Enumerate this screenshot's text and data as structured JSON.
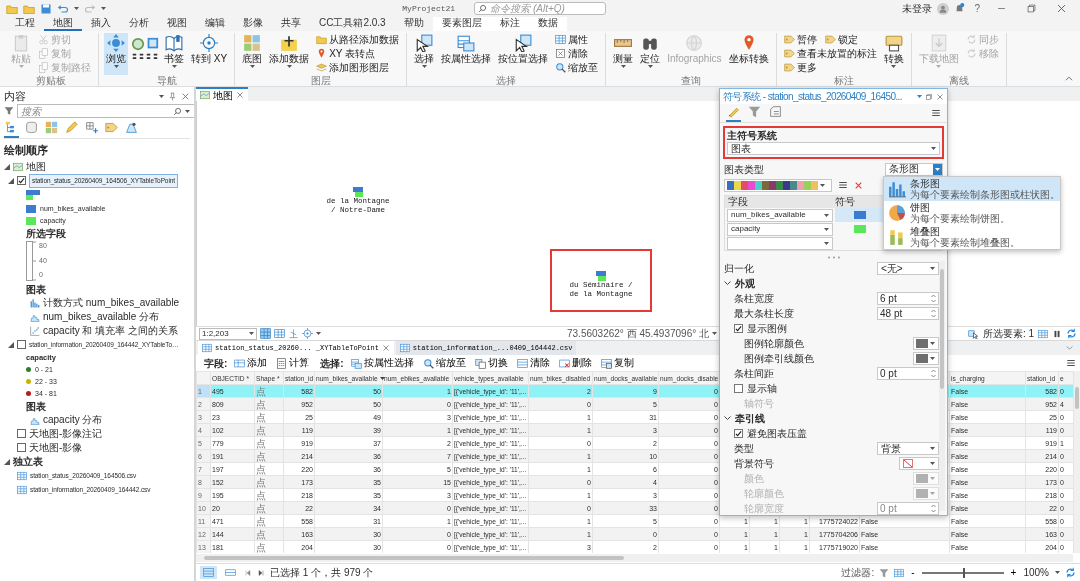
{
  "title_bar": {
    "project": "MyProject21",
    "search": {
      "placeholder": "命令搜索 (Alt+Q)"
    },
    "user": "未登录",
    "help": "?"
  },
  "ribbon_tabs": [
    {
      "label": "工程",
      "kind": "main",
      "selected": false
    },
    {
      "label": "地图",
      "kind": "main",
      "selected": true
    },
    {
      "label": "插入",
      "kind": "main",
      "selected": false
    },
    {
      "label": "分析",
      "kind": "main",
      "selected": false
    },
    {
      "label": "视图",
      "kind": "main",
      "selected": false
    },
    {
      "label": "编辑",
      "kind": "main",
      "selected": false
    },
    {
      "label": "影像",
      "kind": "main",
      "selected": false
    },
    {
      "label": "共享",
      "kind": "main",
      "selected": false
    },
    {
      "label": "CC工具箱2.0.3",
      "kind": "main",
      "selected": false
    },
    {
      "label": "帮助",
      "kind": "main",
      "selected": false
    },
    {
      "label": "要素图层",
      "kind": "context",
      "selected": false
    },
    {
      "label": "标注",
      "kind": "context",
      "selected": false
    },
    {
      "label": "数据",
      "kind": "context",
      "selected": false
    }
  ],
  "ribbon_groups": [
    {
      "title": "剪贴板",
      "columns": [
        {
          "kind": "large",
          "label": "粘贴",
          "dropdown": true,
          "disabled": true,
          "selected": false
        },
        {
          "kind": "stack",
          "rows": [
            [
              {
                "label": "剪切",
                "disabled": true
              }
            ],
            [
              {
                "label": "复制",
                "disabled": true
              }
            ],
            [
              {
                "label": "复制路径",
                "disabled": true
              }
            ]
          ]
        }
      ]
    },
    {
      "title": "导航",
      "columns": [
        {
          "kind": "large",
          "label": "浏览",
          "dropdown": true,
          "disabled": false,
          "selected": true
        },
        {
          "kind": "tools"
        },
        {
          "kind": "large",
          "label": "书签",
          "dropdown": true,
          "disabled": false,
          "selected": false
        },
        {
          "kind": "large",
          "label": "转到 XY",
          "dropdown": false,
          "disabled": false,
          "selected": false
        }
      ]
    },
    {
      "title": "图层",
      "columns": [
        {
          "kind": "large",
          "label": "底图",
          "dropdown": true,
          "disabled": false,
          "selected": false
        },
        {
          "kind": "large",
          "label": "添加数据",
          "dropdown": true,
          "disabled": false,
          "selected": false
        },
        {
          "kind": "stack",
          "rows": [
            [
              {
                "label": "从路径添加数据",
                "disabled": false
              }
            ],
            [
              {
                "label": "XY 表转点",
                "disabled": false
              }
            ],
            [
              {
                "label": "添加图形图层",
                "disabled": false
              }
            ]
          ]
        }
      ]
    },
    {
      "title": "选择",
      "columns": [
        {
          "kind": "large",
          "label": "选择",
          "dropdown": true,
          "disabled": false,
          "selected": false
        },
        {
          "kind": "large",
          "label": "按属性选择",
          "dropdown": false,
          "disabled": false,
          "selected": false
        },
        {
          "kind": "large",
          "label": "按位置选择",
          "dropdown": false,
          "disabled": false,
          "selected": false
        },
        {
          "kind": "stack",
          "rows": [
            [
              {
                "label": "属性",
                "disabled": false
              }
            ],
            [
              {
                "label": "清除",
                "disabled": false
              }
            ],
            [
              {
                "label": "缩放至",
                "disabled": false
              }
            ]
          ]
        }
      ]
    },
    {
      "title": "查询",
      "columns": [
        {
          "kind": "large",
          "label": "测量",
          "dropdown": true,
          "disabled": false,
          "selected": false
        },
        {
          "kind": "large",
          "label": "定位",
          "dropdown": true,
          "disabled": false,
          "selected": false
        },
        {
          "kind": "large",
          "label": "Infographics",
          "dropdown": false,
          "disabled": true,
          "selected": false
        },
        {
          "kind": "large",
          "label": "坐标转换",
          "dropdown": false,
          "disabled": false,
          "selected": false
        }
      ]
    },
    {
      "title": "标注",
      "columns": [
        {
          "kind": "stack",
          "rows": [
            [
              {
                "label": "暂停",
                "disabled": false
              },
              {
                "label": "锁定",
                "disabled": false
              }
            ],
            [
              {
                "label": "查看未放置的标注",
                "disabled": false
              }
            ],
            [
              {
                "label": "更多",
                "disabled": false
              }
            ]
          ]
        },
        {
          "kind": "large",
          "label": "转换",
          "dropdown": true,
          "disabled": false,
          "selected": false
        }
      ]
    },
    {
      "title": "离线",
      "columns": [
        {
          "kind": "large",
          "label": "下载地图",
          "dropdown": true,
          "disabled": true,
          "selected": false
        },
        {
          "kind": "stack",
          "rows": [
            [
              {
                "label": "同步",
                "disabled": true
              }
            ],
            [
              {
                "label": "移除",
                "disabled": true
              }
            ]
          ]
        }
      ]
    }
  ],
  "contents": {
    "title": "内容",
    "search": {
      "placeholder": "搜索"
    },
    "view_tabs": [
      {
        "selected": true
      },
      {
        "selected": false
      },
      {
        "selected": false
      },
      {
        "selected": false
      },
      {
        "selected": false
      },
      {
        "selected": false
      },
      {
        "selected": false
      }
    ],
    "heading": "绘制顺序",
    "tree": [
      {
        "kind": "map",
        "label": "地图",
        "expanded": true,
        "children": [
          {
            "kind": "layer",
            "label": "station_status_20260409_164506_XYTableToPoint",
            "checked": true,
            "selected": true,
            "expanded": true,
            "legend": {
              "kind": "chart",
              "entries": [
                {
                  "label": "num_bikes_available",
                  "color": "#3d7bd0"
                },
                {
                  "label": "capacity",
                  "color": "#5ae85a"
                }
              ],
              "field_heading": "所选字段",
              "scale": [
                "80",
                "40",
                "0"
              ],
              "charts_heading": "图表",
              "charts": [
                {
                  "label": "计数方式 num_bikes_available",
                  "kind": "bar"
                },
                {
                  "label": "num_bikes_available 分布",
                  "kind": "histogram"
                },
                {
                  "label": "capacity 和 填充率 之间的关系",
                  "kind": "scatter"
                }
              ]
            }
          },
          {
            "kind": "layer",
            "label": "station_information_20260409_164442_XYTableTo…",
            "checked": false,
            "selected": false,
            "expanded": true,
            "legend": {
              "kind": "classes",
              "field_heading": "capacity",
              "entries": [
                {
                  "label": "0 - 21",
                  "color": "#2e7d32"
                },
                {
                  "label": "22 - 33",
                  "color": "#c8b400"
                },
                {
                  "label": "34 - 81",
                  "color": "#b71c1c"
                }
              ],
              "charts_heading": "图表",
              "charts": [
                {
                  "label": "capacity 分布",
                  "kind": "histogram"
                }
              ]
            }
          },
          {
            "kind": "layer",
            "label": "天地图-影像注记",
            "checked": false,
            "selected": false
          },
          {
            "kind": "layer",
            "label": "天地图-影像",
            "checked": false,
            "selected": false
          }
        ]
      },
      {
        "kind": "group",
        "label": "独立表",
        "expanded": true,
        "children": [
          {
            "kind": "table",
            "label": "station_status_20260409_164506.csv"
          },
          {
            "kind": "table",
            "label": "station_information_20260409_164442.csv"
          }
        ]
      }
    ]
  },
  "map_view": {
    "tab": {
      "label": "地图",
      "selected": true
    },
    "features": [
      {
        "lines": [
          "de la Montagne",
          "/ Notre-Dame"
        ],
        "highlighted": false
      },
      {
        "lines": [
          "du Séminaire /",
          "de la Montagne"
        ],
        "highlighted": true
      }
    ],
    "scale": "1:2,203",
    "coordinates": "73.5603262° 西 45.4937096° 北",
    "selected_features": "所选要素: 1"
  },
  "table": {
    "tabs": [
      {
        "label": "station_status_20260... _XYTableToPoint",
        "selected": true,
        "closable": true
      },
      {
        "label": "station_information_...0409_164442.csv",
        "selected": false,
        "closable": false
      }
    ],
    "toolbar": [
      {
        "kind": "label",
        "label": "字段:"
      },
      {
        "kind": "button",
        "label": "添加"
      },
      {
        "kind": "button",
        "label": "计算"
      },
      {
        "kind": "label",
        "label": "选择:"
      },
      {
        "kind": "button",
        "label": "按属性选择"
      },
      {
        "kind": "button",
        "label": "缩放至"
      },
      {
        "kind": "button",
        "label": "切换"
      },
      {
        "kind": "button",
        "label": "清除"
      },
      {
        "kind": "button",
        "label": "删除"
      },
      {
        "kind": "button",
        "label": "复制"
      }
    ],
    "columns": [
      {
        "label": "OBJECTID *",
        "sorted": false
      },
      {
        "label": "Shape *",
        "sorted": false
      },
      {
        "label": "station_id",
        "sorted": false
      },
      {
        "label": "num_bikes_available",
        "sorted": true
      },
      {
        "label": "num_ebikes_available",
        "sorted": false
      },
      {
        "label": "vehicle_types_available",
        "sorted": false
      },
      {
        "label": "num_bikes_disabled",
        "sorted": false
      },
      {
        "label": "num_docks_available",
        "sorted": false
      },
      {
        "label": "num_docks_disable",
        "sorted": false
      },
      null,
      null,
      null,
      null,
      null,
      {
        "label": "is_charging",
        "sorted": false
      },
      {
        "label": "station_id",
        "sorted": false
      },
      {
        "label": "e",
        "sorted": false
      }
    ],
    "rows": [
      {
        "number": "1",
        "selected": true,
        "cells": [
          "495",
          "点",
          "582",
          "50",
          "1",
          "[{'vehicle_type_id': '11',...",
          "2",
          "9",
          "0",
          null,
          null,
          null,
          null,
          null,
          "False",
          "582",
          "0"
        ]
      },
      {
        "number": "2",
        "selected": false,
        "cells": [
          "809",
          "点",
          "952",
          "50",
          "0",
          "[{'vehicle_type_id': '11',...",
          "0",
          "5",
          "0",
          null,
          null,
          null,
          null,
          null,
          "False",
          "952",
          "4"
        ]
      },
      {
        "number": "3",
        "selected": false,
        "cells": [
          "23",
          "点",
          "25",
          "49",
          "3",
          "[{'vehicle_type_id': '11',...",
          "1",
          "31",
          "0",
          null,
          null,
          null,
          null,
          null,
          "False",
          "25",
          "0"
        ]
      },
      {
        "number": "4",
        "selected": false,
        "cells": [
          "102",
          "点",
          "119",
          "39",
          "1",
          "[{'vehicle_type_id': '11',...",
          "1",
          "3",
          "0",
          null,
          null,
          null,
          null,
          null,
          "False",
          "119",
          "0"
        ]
      },
      {
        "number": "5",
        "selected": false,
        "cells": [
          "779",
          "点",
          "919",
          "37",
          "2",
          "[{'vehicle_type_id': '11',...",
          "0",
          "2",
          "0",
          null,
          null,
          null,
          null,
          null,
          "False",
          "919",
          "1"
        ]
      },
      {
        "number": "6",
        "selected": false,
        "cells": [
          "191",
          "点",
          "214",
          "36",
          "7",
          "[{'vehicle_type_id': '11',...",
          "1",
          "10",
          "0",
          null,
          null,
          null,
          null,
          null,
          "False",
          "214",
          "0"
        ]
      },
      {
        "number": "7",
        "selected": false,
        "cells": [
          "197",
          "点",
          "220",
          "36",
          "5",
          "[{'vehicle_type_id': '11',...",
          "1",
          "6",
          "0",
          null,
          null,
          null,
          null,
          null,
          "False",
          "220",
          "0"
        ]
      },
      {
        "number": "8",
        "selected": false,
        "cells": [
          "152",
          "点",
          "173",
          "35",
          "15",
          "[{'vehicle_type_id': '11',...",
          "0",
          "4",
          "0",
          null,
          null,
          null,
          null,
          null,
          "False",
          "173",
          "0"
        ]
      },
      {
        "number": "9",
        "selected": false,
        "cells": [
          "195",
          "点",
          "218",
          "35",
          "3",
          "[{'vehicle_type_id': '11',...",
          "1",
          "3",
          "0",
          null,
          null,
          null,
          null,
          null,
          "False",
          "218",
          "0"
        ]
      },
      {
        "number": "10",
        "selected": false,
        "cells": [
          "20",
          "点",
          "22",
          "34",
          "0",
          "[{'vehicle_type_id': '11',...",
          "0",
          "33",
          "0",
          null,
          null,
          null,
          null,
          null,
          "False",
          "22",
          "0"
        ]
      },
      {
        "number": "11",
        "selected": false,
        "cells": [
          "471",
          "点",
          "558",
          "31",
          "1",
          "[{'vehicle_type_id': '11',...",
          "1",
          "5",
          "0",
          "1",
          "1",
          "1",
          "1775724022",
          "False",
          "False",
          "558",
          "0"
        ]
      },
      {
        "number": "12",
        "selected": false,
        "cells": [
          "144",
          "点",
          "163",
          "30",
          "0",
          "[{'vehicle_type_id': '11',...",
          "1",
          "0",
          "0",
          "1",
          "1",
          "1",
          "1775704206",
          "False",
          "False",
          "163",
          "0"
        ]
      },
      {
        "number": "13",
        "selected": false,
        "cells": [
          "181",
          "点",
          "204",
          "30",
          "0",
          "[{'vehicle_type_id': '11',...",
          "3",
          "2",
          "0",
          "1",
          "1",
          "1",
          "1775719020",
          "False",
          "False",
          "204",
          "0"
        ]
      }
    ],
    "status": "已选择 1 个，共 979 个",
    "views": [
      {
        "selected": true
      },
      {
        "selected": false
      }
    ],
    "filter_label": "过滤器:",
    "zoom": {
      "minus": "-",
      "plus": "+",
      "level": 0.5,
      "value": "100%"
    }
  },
  "symbology": {
    "title": "符号系统 - station_status_20260409_16450...",
    "tabs": [
      {
        "selected": true
      },
      {
        "selected": false
      },
      {
        "selected": false
      }
    ],
    "primary": {
      "label": "主符号系统",
      "value": "图表",
      "highlighted": true
    },
    "chart_type": {
      "label": "图表类型",
      "value": "条形图",
      "expanded": true,
      "options": [
        {
          "kind": "bar",
          "label": "条形图",
          "description": "为每个要素绘制条形图或柱状图。",
          "selected": true
        },
        {
          "kind": "pie",
          "label": "饼图",
          "description": "为每个要素绘制饼图。",
          "selected": false
        },
        {
          "kind": "stacked",
          "label": "堆叠图",
          "description": "为每个要素绘制堆叠图。",
          "selected": false
        }
      ]
    },
    "field_headers": [
      "字段",
      "符号"
    ],
    "fields": [
      {
        "label": "num_bikes_available",
        "color": "#3d7bd0",
        "selected": true
      },
      {
        "label": "capacity",
        "color": "#5ae85a",
        "selected": false
      },
      {
        "selected": false
      }
    ],
    "properties": [
      {
        "kind": "dropdown",
        "label": "归一化",
        "value": "<无>",
        "disabled": false
      },
      {
        "kind": "section",
        "label": "外观",
        "expanded": true,
        "children": [
          {
            "kind": "spinner",
            "label": "条柱宽度",
            "value": "6 pt",
            "disabled": false
          },
          {
            "kind": "spinner",
            "label": "最大条柱长度",
            "value": "48 pt",
            "disabled": false
          },
          {
            "kind": "checkbox",
            "label": "显示图例",
            "checked": true,
            "disabled": false,
            "children": [
              {
                "kind": "color",
                "label": "图例轮廓颜色",
                "disabled": false
              },
              {
                "kind": "color",
                "label": "图例牵引线颜色",
                "disabled": false
              }
            ]
          },
          {
            "kind": "spinner",
            "label": "条柱间距",
            "value": "0 pt",
            "disabled": false
          },
          {
            "kind": "checkbox",
            "label": "显示轴",
            "checked": false,
            "disabled": false,
            "children": [
              {
                "kind": "label",
                "label": "轴符号",
                "disabled": true
              }
            ]
          }
        ]
      },
      {
        "kind": "section",
        "label": "牵引线",
        "expanded": true,
        "children": [
          {
            "kind": "checkbox",
            "label": "避免图表压盖",
            "checked": true,
            "disabled": false
          },
          {
            "kind": "dropdown",
            "label": "类型",
            "value": "背景",
            "disabled": false
          },
          {
            "kind": "symbol",
            "label": "背景符号",
            "disabled": false,
            "children": [
              {
                "kind": "color",
                "label": "颜色",
                "disabled": true
              },
              {
                "kind": "color",
                "label": "轮廓颜色",
                "disabled": true
              },
              {
                "kind": "spinner",
                "label": "轮廓宽度",
                "value": "0 pt",
                "disabled": true
              }
            ]
          }
        ]
      }
    ]
  }
}
